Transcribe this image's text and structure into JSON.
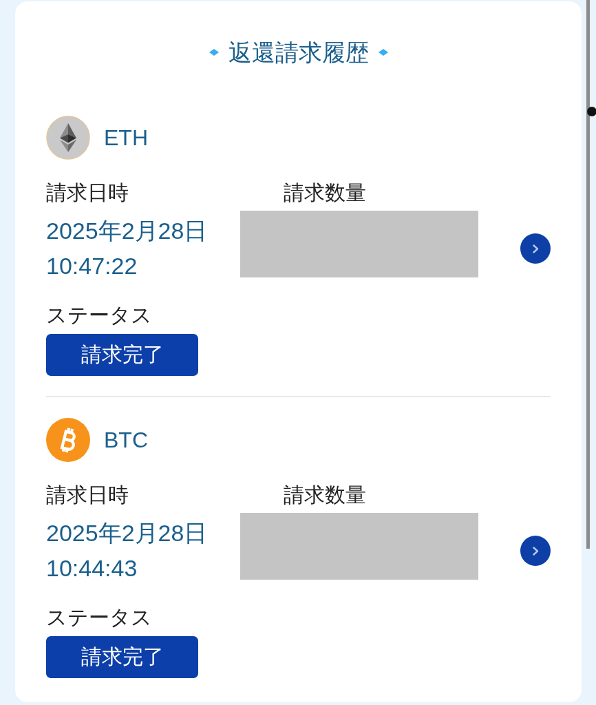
{
  "title": "返還請求履歴",
  "claims": [
    {
      "kind": "ether",
      "coin": "ETH",
      "date_label": "請求日時",
      "datetime": "2025年2月28日 10:47:22",
      "amount_label": "請求数量",
      "status_label": "ステータス",
      "status": "請求完了"
    },
    {
      "kind": "bitcoin",
      "coin": "BTC",
      "date_label": "請求日時",
      "datetime": "2025年2月28日 10:44:43",
      "amount_label": "請求数量",
      "status_label": "ステータス",
      "status": "請求完了"
    }
  ]
}
